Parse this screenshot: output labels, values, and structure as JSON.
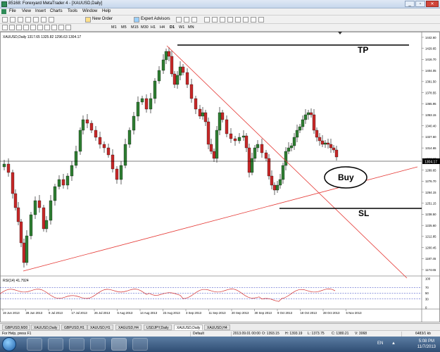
{
  "window": {
    "title": "85168: Forexyard MetaTrader 4 - [XAUUSD,Daily]",
    "controls": [
      "_",
      "▫",
      "✕"
    ]
  },
  "menu": [
    "File",
    "View",
    "Insert",
    "Charts",
    "Tools",
    "Window",
    "Help"
  ],
  "toolbar": {
    "new_order": "New Order",
    "expert_advisors": "Expert Advisors"
  },
  "timeframes": [
    "M1",
    "M5",
    "M15",
    "M30",
    "H1",
    "H4",
    "D1",
    "W1",
    "MN"
  ],
  "chart": {
    "info": "XAUUSD,Daily  1317.65 1325.82 1296.63 1304.17",
    "price_labels": [
      "1442.60",
      "1429.65",
      "1416.70",
      "1404.05",
      "1391.50",
      "1378.55",
      "1365.95",
      "1353.15",
      "1340.40",
      "1327.60",
      "1314.65",
      "1302.05",
      "1289.65",
      "1276.70",
      "1264.15",
      "1251.15",
      "1238.50",
      "1225.60",
      "1212.85",
      "1200.45",
      "1187.45",
      "1174.65"
    ],
    "current_price": "1304.17",
    "date_labels": [
      "19 Jun 2013",
      "28 Jun 2013",
      "9 Jul 2013",
      "17 Jul 2013",
      "26 Jul 2013",
      "6 Aug 2013",
      "14 Aug 2013",
      "23 Aug 2013",
      "3 Sep 2013",
      "11 Sep 2013",
      "20 Sep 2013",
      "30 Sep 2013",
      "9 Oct 2013",
      "18 Oct 2013",
      "28 Oct 2013",
      "6 Nov 2013"
    ],
    "annotations": {
      "tp": "TP",
      "sl": "SL",
      "buy": "Buy"
    },
    "rsi_label": "RSI(14) 41.7924",
    "rsi_levels": [
      "100",
      "70",
      "50",
      "30",
      "0"
    ],
    "colors": {
      "bull": "#2e7d32",
      "bear": "#c62828",
      "trend": "#e53935",
      "rsi": "#d32f2f",
      "level": "#2f3cbf"
    }
  },
  "tabs": [
    "GBPUSD,M30",
    "XAUUSD,Daily",
    "GBPUSD,H1",
    "XAUUSD,H1",
    "XAGUSD,H4",
    "USDJPY,Daily",
    "XAUUSD,Daily",
    "XAUUSD,H4"
  ],
  "active_tab": 6,
  "status": {
    "help": "For Help, press F1",
    "profile": "Default",
    "datetime": "2013.09.01 00:00",
    "open": "O: 1393.15",
    "high": "H: 1393.19",
    "low": "L: 1373.75",
    "close": "C: 1380.21",
    "volume": "V: 3068",
    "traffic": "6483/1 kb"
  },
  "taskbar": {
    "lang": "EN",
    "time": "5:08 PM",
    "date": "11/7/2013"
  }
}
